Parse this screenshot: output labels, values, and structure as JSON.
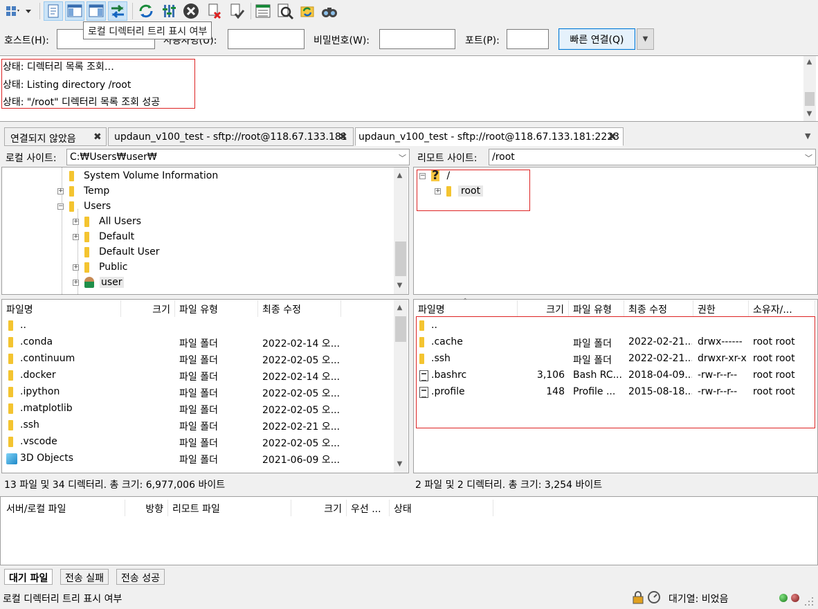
{
  "tooltip": "로컬 디렉터리 트리 표시 여부",
  "toolbar": {
    "icons": [
      "site-manager-icon",
      "message-log-icon",
      "local-tree-icon",
      "remote-tree-icon",
      "transfer-queue-icon",
      "refresh-icon",
      "process-queue-icon",
      "cancel-icon",
      "disconnect-icon",
      "reconnect-icon",
      "directory-listing-filter-icon",
      "compare-icon",
      "sync-browse-icon",
      "search-icon"
    ]
  },
  "quickconnect": {
    "host_label": "호스트(H):",
    "host_value": "",
    "user_label": "사용자명(U):",
    "user_value": "",
    "pass_label": "비밀번호(W):",
    "pass_value": "",
    "port_label": "포트(P):",
    "port_value": "",
    "connect_label": "빠른 연결(Q)"
  },
  "log": [
    "상태:  디렉터리 목록 조회…",
    "상태:  Listing directory /root",
    "상태:  \"/root\" 디렉터리 목록 조회 성공"
  ],
  "tabs": [
    {
      "label": "연결되지 않았음"
    },
    {
      "label": "updaun_v100_test - sftp://root@118.67.133.181"
    },
    {
      "label": "updaun_v100_test - sftp://root@118.67.133.181:2223"
    }
  ],
  "local": {
    "site_label": "로컬 사이트:",
    "site_path": "C:₩Users₩user₩",
    "tree": [
      {
        "label": "System Volume Information",
        "indent": 0,
        "expander": ""
      },
      {
        "label": "Temp",
        "indent": 0,
        "expander": "+"
      },
      {
        "label": "Users",
        "indent": 0,
        "expander": "−"
      },
      {
        "label": "All Users",
        "indent": 1,
        "expander": "+"
      },
      {
        "label": "Default",
        "indent": 1,
        "expander": "+"
      },
      {
        "label": "Default User",
        "indent": 1,
        "expander": ""
      },
      {
        "label": "Public",
        "indent": 1,
        "expander": "+"
      },
      {
        "label": "user",
        "indent": 1,
        "expander": "+",
        "user": true
      }
    ],
    "columns": [
      "파일명",
      "크기",
      "파일 유형",
      "최종 수정"
    ],
    "files": [
      {
        "name": "..",
        "size": "",
        "type": "",
        "modified": ""
      },
      {
        "name": ".conda",
        "size": "",
        "type": "파일 폴더",
        "modified": "2022-02-14 오..."
      },
      {
        "name": ".continuum",
        "size": "",
        "type": "파일 폴더",
        "modified": "2022-02-05 오..."
      },
      {
        "name": ".docker",
        "size": "",
        "type": "파일 폴더",
        "modified": "2022-02-14 오..."
      },
      {
        "name": ".ipython",
        "size": "",
        "type": "파일 폴더",
        "modified": "2022-02-05 오..."
      },
      {
        "name": ".matplotlib",
        "size": "",
        "type": "파일 폴더",
        "modified": "2022-02-05 오..."
      },
      {
        "name": ".ssh",
        "size": "",
        "type": "파일 폴더",
        "modified": "2022-02-21 오..."
      },
      {
        "name": ".vscode",
        "size": "",
        "type": "파일 폴더",
        "modified": "2022-02-05 오..."
      },
      {
        "name": "3D Objects",
        "size": "",
        "type": "파일 폴더",
        "modified": "2021-06-09 오...",
        "cube": true
      }
    ],
    "status": "13 파일 및 34 디렉터리. 총 크기: 6,977,006 바이트"
  },
  "remote": {
    "site_label": "리모트 사이트:",
    "site_path": "/root",
    "tree": [
      {
        "label": "/",
        "indent": 0,
        "expander": "−",
        "unknown": true
      },
      {
        "label": "root",
        "indent": 1,
        "expander": "+"
      }
    ],
    "columns": [
      "파일명",
      "크기",
      "파일 유형",
      "최종 수정",
      "권한",
      "소유자/..."
    ],
    "files": [
      {
        "name": "..",
        "size": "",
        "type": "",
        "modified": "",
        "perm": "",
        "owner": ""
      },
      {
        "name": ".cache",
        "size": "",
        "type": "파일 폴더",
        "modified": "2022-02-21...",
        "perm": "drwx------",
        "owner": "root root"
      },
      {
        "name": ".ssh",
        "size": "",
        "type": "파일 폴더",
        "modified": "2022-02-21...",
        "perm": "drwxr-xr-x",
        "owner": "root root"
      },
      {
        "name": ".bashrc",
        "size": "3,106",
        "type": "Bash RC...",
        "modified": "2018-04-09...",
        "perm": "-rw-r--r--",
        "owner": "root root",
        "file": true
      },
      {
        "name": ".profile",
        "size": "148",
        "type": "Profile ...",
        "modified": "2015-08-18...",
        "perm": "-rw-r--r--",
        "owner": "root root",
        "file": true
      }
    ],
    "status": "2 파일 및 2 디렉터리. 총 크기: 3,254 바이트"
  },
  "queue": {
    "columns": [
      "서버/로컬 파일",
      "방향",
      "리모트 파일",
      "크기",
      "우선 ...",
      "상태"
    ],
    "tabs": [
      "대기 파일",
      "전송 실패",
      "전송 성공"
    ]
  },
  "statusbar": {
    "text": "로컬 디렉터리 트리 표시 여부",
    "queue": "대기열: 비었음"
  }
}
